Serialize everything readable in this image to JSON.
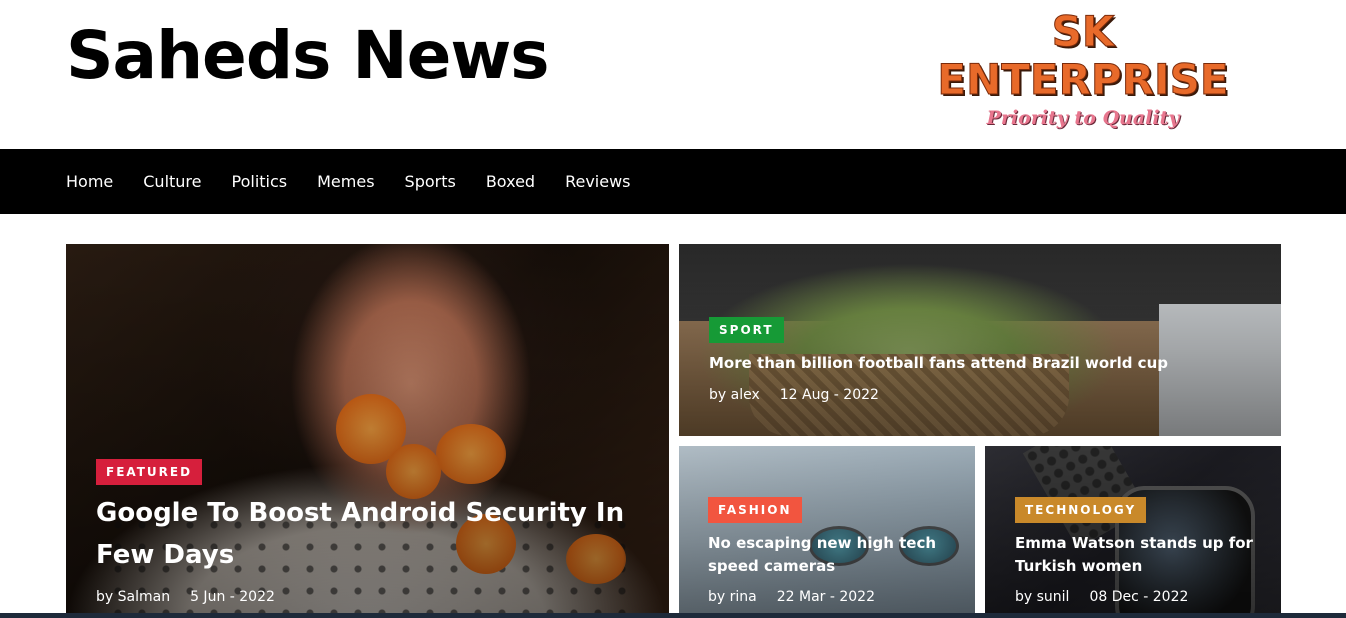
{
  "site": {
    "title": "Saheds News"
  },
  "ad": {
    "brand": "SK ENTERPRISE",
    "tagline": "Priority to Quality"
  },
  "nav": {
    "items": [
      {
        "label": "Home"
      },
      {
        "label": "Culture"
      },
      {
        "label": "Politics"
      },
      {
        "label": "Memes"
      },
      {
        "label": "Sports"
      },
      {
        "label": "Boxed"
      },
      {
        "label": "Reviews"
      }
    ]
  },
  "posts": [
    {
      "category": "FEATURED",
      "category_color": "#d61f3c",
      "title": "Google To Boost Android Security In Few Days",
      "author": "by Salman",
      "date": "5 Jun - 2022"
    },
    {
      "category": "SPORT",
      "category_color": "#169a36",
      "title": "More than billion football fans attend Brazil world cup",
      "author": "by alex",
      "date": "12 Aug - 2022"
    },
    {
      "category": "FASHION",
      "category_color": "#f2553f",
      "title": "No escaping new high tech speed cameras",
      "author": "by rina",
      "date": "22 Mar - 2022"
    },
    {
      "category": "TECHNOLOGY",
      "category_color": "#c9892a",
      "title": "Emma Watson stands up for Turkish women",
      "author": "by sunil",
      "date": "08 Dec - 2022"
    }
  ]
}
